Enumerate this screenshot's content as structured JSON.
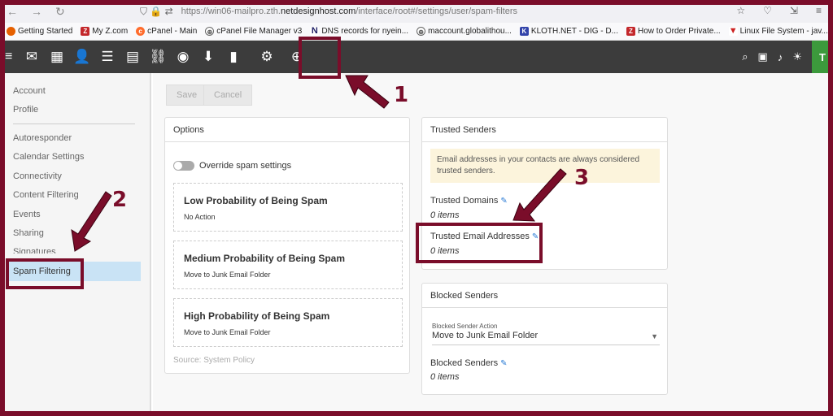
{
  "browser": {
    "url_prefix": "https://win06-mailpro.zth.",
    "url_domain": "netdesignhost.com",
    "url_path": "/interface/root#/settings/user/spam-filters"
  },
  "bookmarks": [
    {
      "label": "Getting Started",
      "icon": "firefox-icon",
      "color": "#e66000"
    },
    {
      "label": "My Z.com",
      "icon": "z-icon",
      "color": "#c3272b"
    },
    {
      "label": "cPanel - Main",
      "icon": "cpanel-icon",
      "color": "#ff6c2c"
    },
    {
      "label": "cPanel File Manager v3",
      "icon": "globe-icon",
      "color": "#666666"
    },
    {
      "label": "DNS records for nyein...",
      "icon": "n-icon",
      "color": "#222266"
    },
    {
      "label": "maccount.globalithou...",
      "icon": "globe-icon",
      "color": "#666666"
    },
    {
      "label": "KLOTH.NET - DIG - D...",
      "icon": "kloth-icon",
      "color": "#3344aa"
    },
    {
      "label": "How to Order Private...",
      "icon": "z-icon",
      "color": "#c3272b"
    },
    {
      "label": "Linux File System - jav...",
      "icon": "v-icon",
      "color": "#cc2222"
    }
  ],
  "toolbar": {
    "icons": [
      "mail-icon",
      "calendar-icon",
      "contacts-icon",
      "tasks-icon",
      "notes-icon",
      "sitemap-icon",
      "rss-icon",
      "download-icon",
      "reports-icon",
      "settings-icon",
      "add-icon"
    ],
    "avatar": "T"
  },
  "sidebar": {
    "items": [
      {
        "label": "Account"
      },
      {
        "label": "Profile"
      },
      {
        "label": "Autoresponder"
      },
      {
        "label": "Calendar Settings"
      },
      {
        "label": "Connectivity"
      },
      {
        "label": "Content Filtering"
      },
      {
        "label": "Events"
      },
      {
        "label": "Sharing"
      },
      {
        "label": "Signatures"
      },
      {
        "label": "Spam Filtering"
      }
    ]
  },
  "actions": {
    "save": "Save",
    "cancel": "Cancel"
  },
  "options": {
    "title": "Options",
    "override_label": "Override spam settings",
    "low": {
      "title": "Low Probability of Being Spam",
      "action": "No Action"
    },
    "medium": {
      "title": "Medium Probability of Being Spam",
      "action": "Move to Junk Email Folder"
    },
    "high": {
      "title": "High Probability of Being Spam",
      "action": "Move to Junk Email Folder"
    },
    "source": "Source: System Policy"
  },
  "trusted": {
    "title": "Trusted Senders",
    "info": "Email addresses in your contacts are always considered trusted senders.",
    "domains_label": "Trusted Domains",
    "domains_count": "0 items",
    "emails_label": "Trusted Email Addresses",
    "emails_count": "0 items"
  },
  "blocked": {
    "title": "Blocked Senders",
    "action_label": "Blocked Sender Action",
    "action_value": "Move to Junk Email Folder",
    "senders_label": "Blocked Senders",
    "senders_count": "0 items"
  },
  "annotations": {
    "n1": "1",
    "n2": "2",
    "n3": "3"
  },
  "colors": {
    "annotation": "#7a0d2a",
    "toolbar": "#3c3c3c",
    "selection": "#c9e3f5",
    "info": "#fcf4dc"
  }
}
